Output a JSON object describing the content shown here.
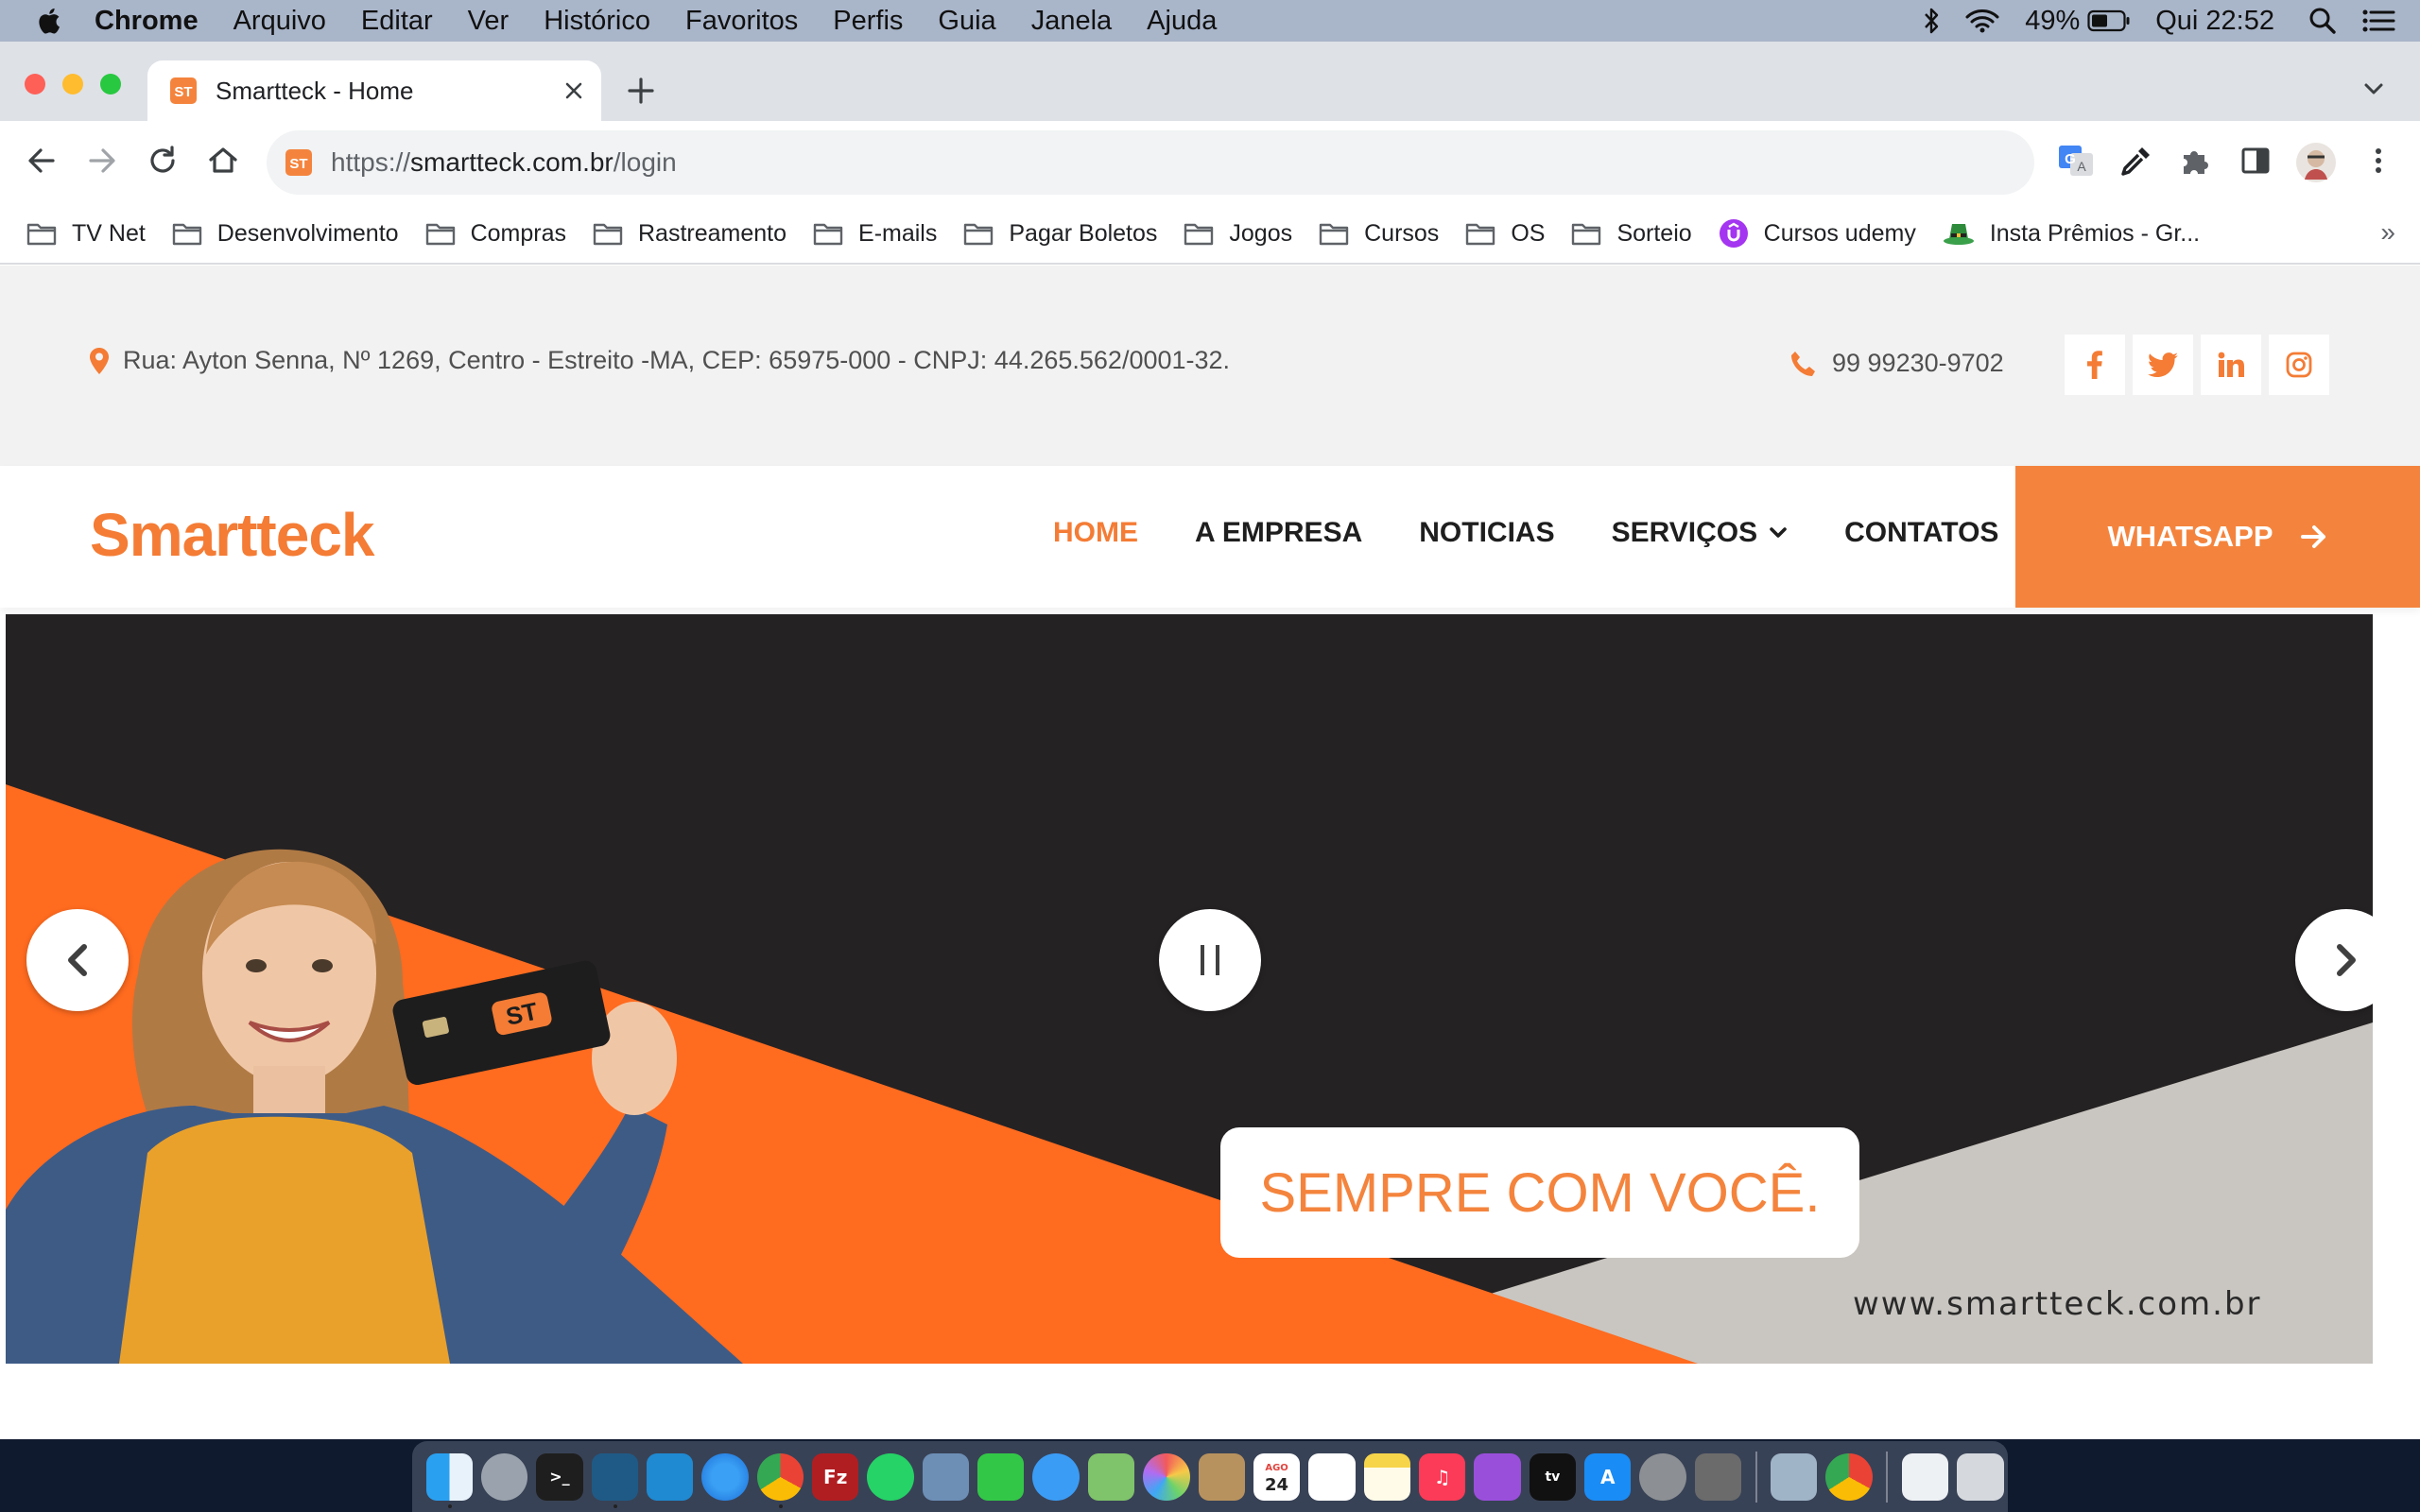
{
  "menubar": {
    "app": "Chrome",
    "items": [
      "Arquivo",
      "Editar",
      "Ver",
      "Histórico",
      "Favoritos",
      "Perfis",
      "Guia",
      "Janela",
      "Ajuda"
    ],
    "battery": "49%",
    "clock": "Qui 22:52"
  },
  "tab": {
    "title": "Smartteck - Home",
    "favicon_text": "ST"
  },
  "omnibox": {
    "scheme": "https://",
    "host": "smartteck.com.br",
    "path": "/login"
  },
  "bookmarks": [
    {
      "label": "TV Net",
      "icon": "folder-icon"
    },
    {
      "label": "Desenvolvimento",
      "icon": "folder-icon"
    },
    {
      "label": "Compras",
      "icon": "folder-icon"
    },
    {
      "label": "Rastreamento",
      "icon": "folder-icon"
    },
    {
      "label": "E-mails",
      "icon": "folder-icon"
    },
    {
      "label": "Pagar Boletos",
      "icon": "folder-icon"
    },
    {
      "label": "Jogos",
      "icon": "folder-icon"
    },
    {
      "label": "Cursos",
      "icon": "folder-icon"
    },
    {
      "label": "OS",
      "icon": "folder-icon"
    },
    {
      "label": "Sorteio",
      "icon": "folder-icon"
    },
    {
      "label": "Cursos udemy",
      "icon": "udemy-icon"
    },
    {
      "label": "Insta Prêmios - Gr...",
      "icon": "leprechaun-hat-icon"
    }
  ],
  "site": {
    "address": "Rua: Ayton Senna, Nº 1269, Centro - Estreito -MA, CEP: 65975-000 - CNPJ: 44.265.562/0001-32.",
    "phone": "99 99230-9702",
    "social": [
      "facebook-icon",
      "twitter-icon",
      "linkedin-icon",
      "instagram-icon"
    ],
    "logo": "Smartteck",
    "nav": {
      "home": "HOME",
      "empresa": "A EMPRESA",
      "noticias": "NOTICIAS",
      "servicos": "SERVIÇOS",
      "contatos": "CONTATOS"
    },
    "cta": "WHATSAPP",
    "hero": {
      "caption": "SEMPRE COM VOCÊ.",
      "url": "www.smartteck.com.br",
      "card_text": "ST"
    }
  },
  "colors": {
    "brand_orange": "#f47c35",
    "hero_dark": "#252223",
    "hero_orange": "#ff6b1f",
    "hero_grey": "#c9c6c1"
  },
  "dock": [
    "Finder",
    "Launchpad",
    "Terminal",
    "MySQL Workbench",
    "Visual Studio Code",
    "Safari",
    "Chrome",
    "FileZilla",
    "WhatsApp",
    "Preview",
    "FaceTime",
    "Messages",
    "Maps",
    "Photos",
    "Contacts",
    "Calendar",
    "Reminders",
    "Notes",
    "Music",
    "Podcasts",
    "TV",
    "App Store",
    "System Preferences",
    "Calculator",
    "Image Capture",
    "Chrome",
    "Documents",
    "Trash"
  ],
  "dock_calendar": {
    "month": "AGO",
    "day": "24"
  }
}
